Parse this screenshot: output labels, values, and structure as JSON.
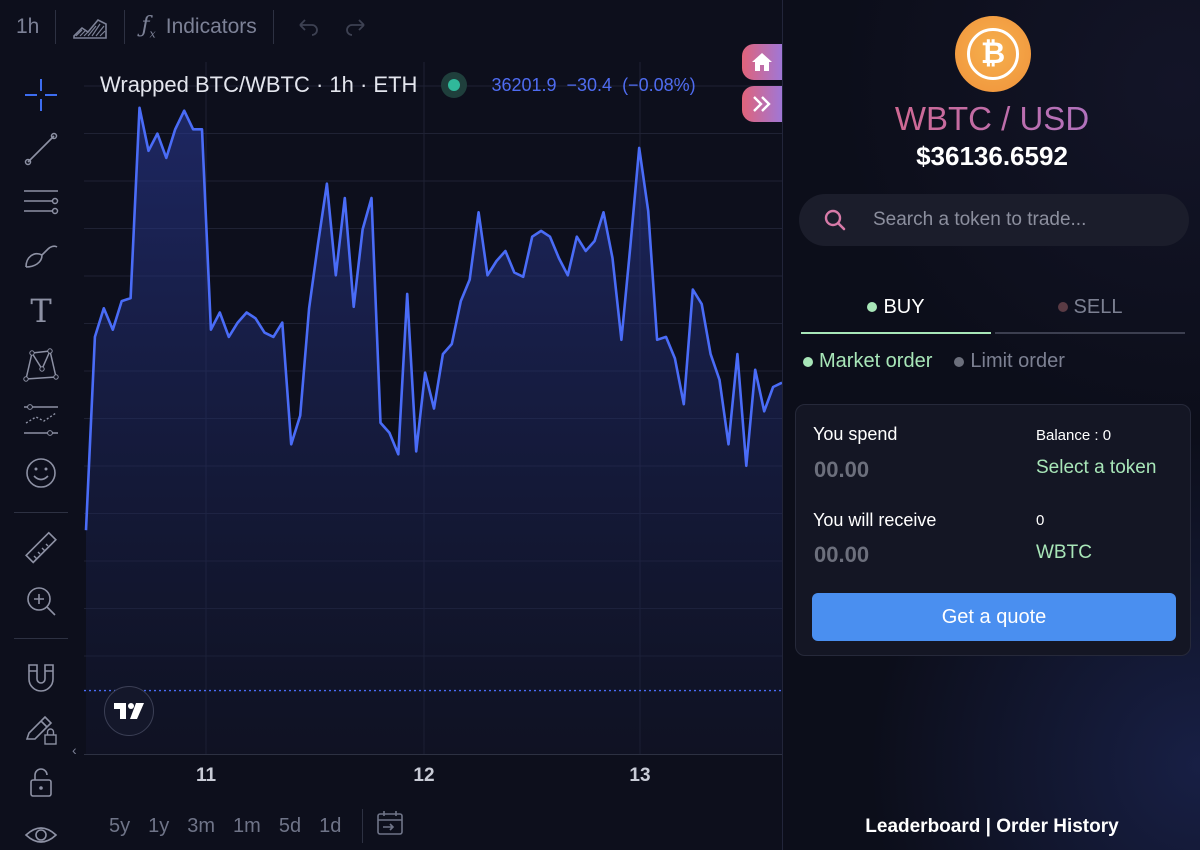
{
  "toolbar": {
    "interval": "1h",
    "indicators_label": "Indicators"
  },
  "legend": {
    "symbol": "Wrapped BTC/WBTC · 1h · ETH",
    "last_price": "36201.9",
    "change": "−30.4",
    "change_pct": "(−0.08%)"
  },
  "x_axis": {
    "ticks": [
      "11",
      "12",
      "13"
    ]
  },
  "range_buttons": [
    "5y",
    "1y",
    "3m",
    "1m",
    "5d",
    "1d"
  ],
  "chart_data": {
    "type": "area",
    "color": "#4a6cf7",
    "x_ticks": [
      "11",
      "12",
      "13"
    ],
    "values": [
      36020,
      36155,
      36175,
      36160,
      36180,
      36182,
      36315,
      36285,
      36297,
      36280,
      36300,
      36313,
      36300,
      36300,
      36160,
      36172,
      36155,
      36165,
      36172,
      36168,
      36158,
      36155,
      36165,
      36080,
      36100,
      36175,
      36220,
      36262,
      36198,
      36252,
      36176,
      36230,
      36252,
      36095,
      36088,
      36073,
      36185,
      36075,
      36130,
      36105,
      36143,
      36150,
      36180,
      36195,
      36242,
      36198,
      36208,
      36215,
      36200,
      36197,
      36225,
      36229,
      36225,
      36210,
      36198,
      36225,
      36215,
      36222,
      36242,
      36210,
      36153,
      36218,
      36287,
      36243,
      36153,
      36155,
      36140,
      36108,
      36188,
      36178,
      36143,
      36125,
      36080,
      36143,
      36065,
      36132,
      36103,
      36120,
      36123
    ],
    "reference_line": 35908,
    "grid": true,
    "legend_position": "top-left"
  },
  "panel": {
    "coin_symbol": "₿",
    "pair": "WBTC / USD",
    "price": "$36136.6592",
    "search_placeholder": "Search a token to trade...",
    "buy_label": "BUY",
    "sell_label": "SELL",
    "market_order": "Market order",
    "limit_order": "Limit order",
    "spend_label": "You spend",
    "spend_amount": "00.00",
    "balance": "Balance : 0",
    "select_token": "Select a token",
    "receive_label": "You will receive",
    "receive_amount": "00.00",
    "receive_count": "0",
    "receive_token": "WBTC",
    "quote_button": "Get a quote",
    "links": "Leaderboard | Order History"
  },
  "colors": {
    "accent_blue": "#4a8ff0",
    "line_blue": "#4a6cf7",
    "green": "#a8e6b8",
    "gradient_start": "#e0637a",
    "gradient_end": "#a077d6",
    "coin_orange": "#f4a340"
  }
}
